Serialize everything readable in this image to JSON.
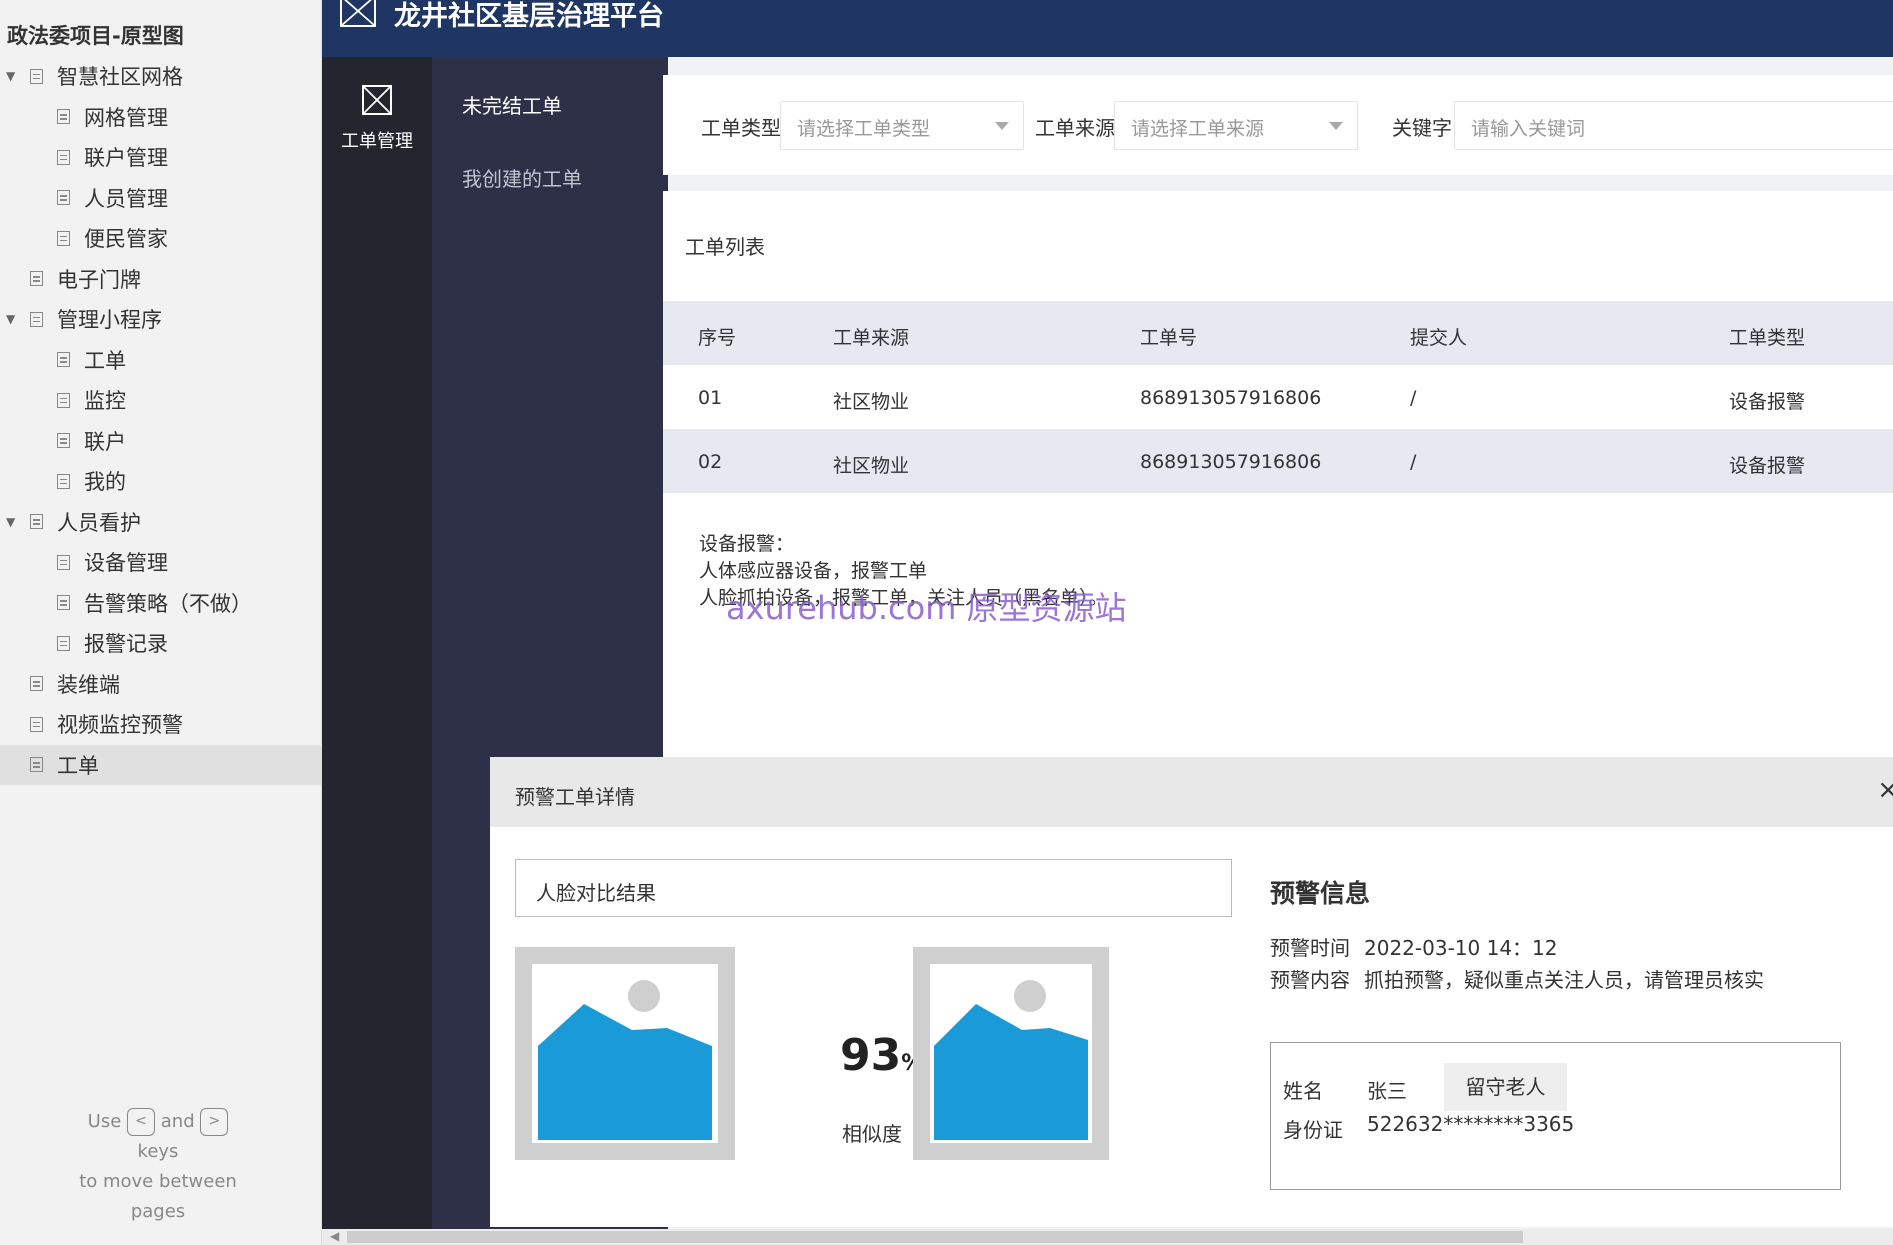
{
  "sitemap": {
    "project_title": "政法委项目-原型图",
    "items": [
      {
        "label": "智慧社区网格",
        "level": 0,
        "expanded": true
      },
      {
        "label": "网格管理",
        "level": 1
      },
      {
        "label": "联户管理",
        "level": 1
      },
      {
        "label": "人员管理",
        "level": 1
      },
      {
        "label": "便民管家",
        "level": 1
      },
      {
        "label": "电子门牌",
        "level": 0
      },
      {
        "label": "管理小程序",
        "level": 0,
        "expanded": true
      },
      {
        "label": "工单",
        "level": 1
      },
      {
        "label": "监控",
        "level": 1
      },
      {
        "label": "联户",
        "level": 1
      },
      {
        "label": "我的",
        "level": 1
      },
      {
        "label": "人员看护",
        "level": 0,
        "expanded": true
      },
      {
        "label": "设备管理",
        "level": 1
      },
      {
        "label": "告警策略（不做）",
        "level": 1
      },
      {
        "label": "报警记录",
        "level": 1
      },
      {
        "label": "装维端",
        "level": 0
      },
      {
        "label": "视频监控预警",
        "level": 0
      },
      {
        "label": "工单",
        "level": 0,
        "selected": true
      }
    ],
    "hint": {
      "use": "Use",
      "and": "and",
      "keys": "keys",
      "move": "to move between",
      "pages": "pages",
      "prev_key": "<",
      "next_key": ">"
    }
  },
  "app": {
    "title": "龙井社区基层治理平台",
    "nav1": {
      "label": "工单管理"
    },
    "nav2": {
      "active": "未完结工单",
      "inactive": "我创建的工单"
    }
  },
  "filter": {
    "type_label": "工单类型",
    "type_placeholder": "请选择工单类型",
    "source_label": "工单来源",
    "source_placeholder": "请选择工单来源",
    "keyword_label": "关键字",
    "keyword_placeholder": "请输入关键词"
  },
  "list": {
    "title": "工单列表",
    "columns": [
      "序号",
      "工单来源",
      "工单号",
      "提交人",
      "工单类型"
    ],
    "rows": [
      {
        "no": "01",
        "source": "社区物业",
        "id": "868913057916806",
        "submitter": "/",
        "type": "设备报警"
      },
      {
        "no": "02",
        "source": "社区物业",
        "id": "868913057916806",
        "submitter": "/",
        "type": "设备报警"
      }
    ],
    "note": [
      "设备报警：",
      "人体感应器设备，报警工单",
      "人脸抓拍设备，报警工单，关注人员（黑名单）。"
    ]
  },
  "watermark": "axurehub.com 原型资源站",
  "modal": {
    "title": "预警工单详情",
    "close": "×",
    "face_title": "人脸对比结果",
    "similarity_value": "93",
    "similarity_unit": "%",
    "similarity_label": "相似度",
    "alert_title": "预警信息",
    "alert_time_label": "预警时间",
    "alert_time": "2022-03-10  14：12",
    "alert_content_label": "预警内容",
    "alert_content": "抓拍预警，疑似重点关注人员，请管理员核实",
    "person": {
      "name_label": "姓名",
      "name": "张三",
      "tag": "留守老人",
      "id_label": "身份证",
      "id": "522632********3365"
    }
  },
  "colors": {
    "topbar": "#1f3664",
    "nav1": "#23262e",
    "nav2": "#2d3047",
    "image_fill": "#1a9bd7"
  }
}
